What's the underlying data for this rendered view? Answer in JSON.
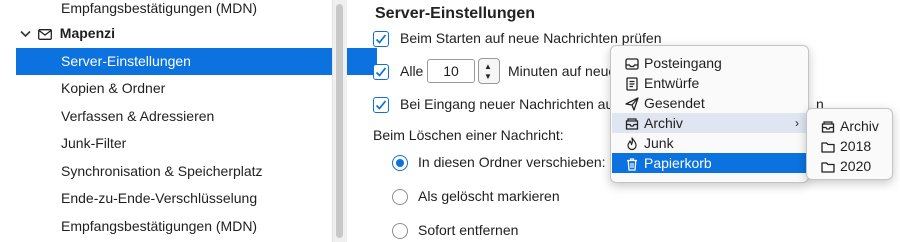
{
  "sidebar": {
    "top_item": "Empfangsbestätigungen (MDN)",
    "account": {
      "name": "Mapenzi",
      "expanded": true
    },
    "items": [
      {
        "label": "Server-Einstellungen",
        "selected": true
      },
      {
        "label": "Kopien & Ordner",
        "selected": false
      },
      {
        "label": "Verfassen & Adressieren",
        "selected": false
      },
      {
        "label": "Junk-Filter",
        "selected": false
      },
      {
        "label": "Synchronisation & Speicherplatz",
        "selected": false
      },
      {
        "label": "Ende-zu-Ende-Verschlüsselung",
        "selected": false
      },
      {
        "label": "Empfangsbestätigungen (MDN)",
        "selected": false
      }
    ]
  },
  "main": {
    "section_title": "Server-Einstellungen",
    "check_startup": {
      "label": "Beim Starten auf neue Nachrichten prüfen",
      "checked": true
    },
    "check_interval": {
      "prefix": "Alle",
      "value": "10",
      "suffix": "Minuten auf neue",
      "checked": true
    },
    "check_new": {
      "label": "Bei Eingang neuer Nachrichten au",
      "tail": "n",
      "checked": true
    },
    "delete_label": "Beim Löschen einer Nachricht:",
    "radios": [
      {
        "label": "In diesen Ordner verschieben:",
        "selected": true
      },
      {
        "label": "Als gelöscht markieren",
        "selected": false
      },
      {
        "label": "Sofort entfernen",
        "selected": false
      }
    ]
  },
  "folder_menu": {
    "items": [
      {
        "label": "Posteingang",
        "icon": "inbox-icon"
      },
      {
        "label": "Entwürfe",
        "icon": "draft-icon"
      },
      {
        "label": "Gesendet",
        "icon": "send-icon"
      },
      {
        "label": "Archiv",
        "icon": "archive-icon",
        "submenu": true,
        "state": "hover"
      },
      {
        "label": "Junk",
        "icon": "junk-icon"
      },
      {
        "label": "Papierkorb",
        "icon": "trash-icon",
        "state": "active"
      }
    ]
  },
  "archive_submenu": {
    "items": [
      {
        "label": "Archiv",
        "icon": "archive-icon"
      },
      {
        "label": "2018",
        "icon": "folder-icon"
      },
      {
        "label": "2020",
        "icon": "folder-icon"
      }
    ]
  },
  "colors": {
    "accent": "#0b72e0",
    "hover": "#dfe6f1",
    "sidebar_bg": "#ffffff"
  }
}
